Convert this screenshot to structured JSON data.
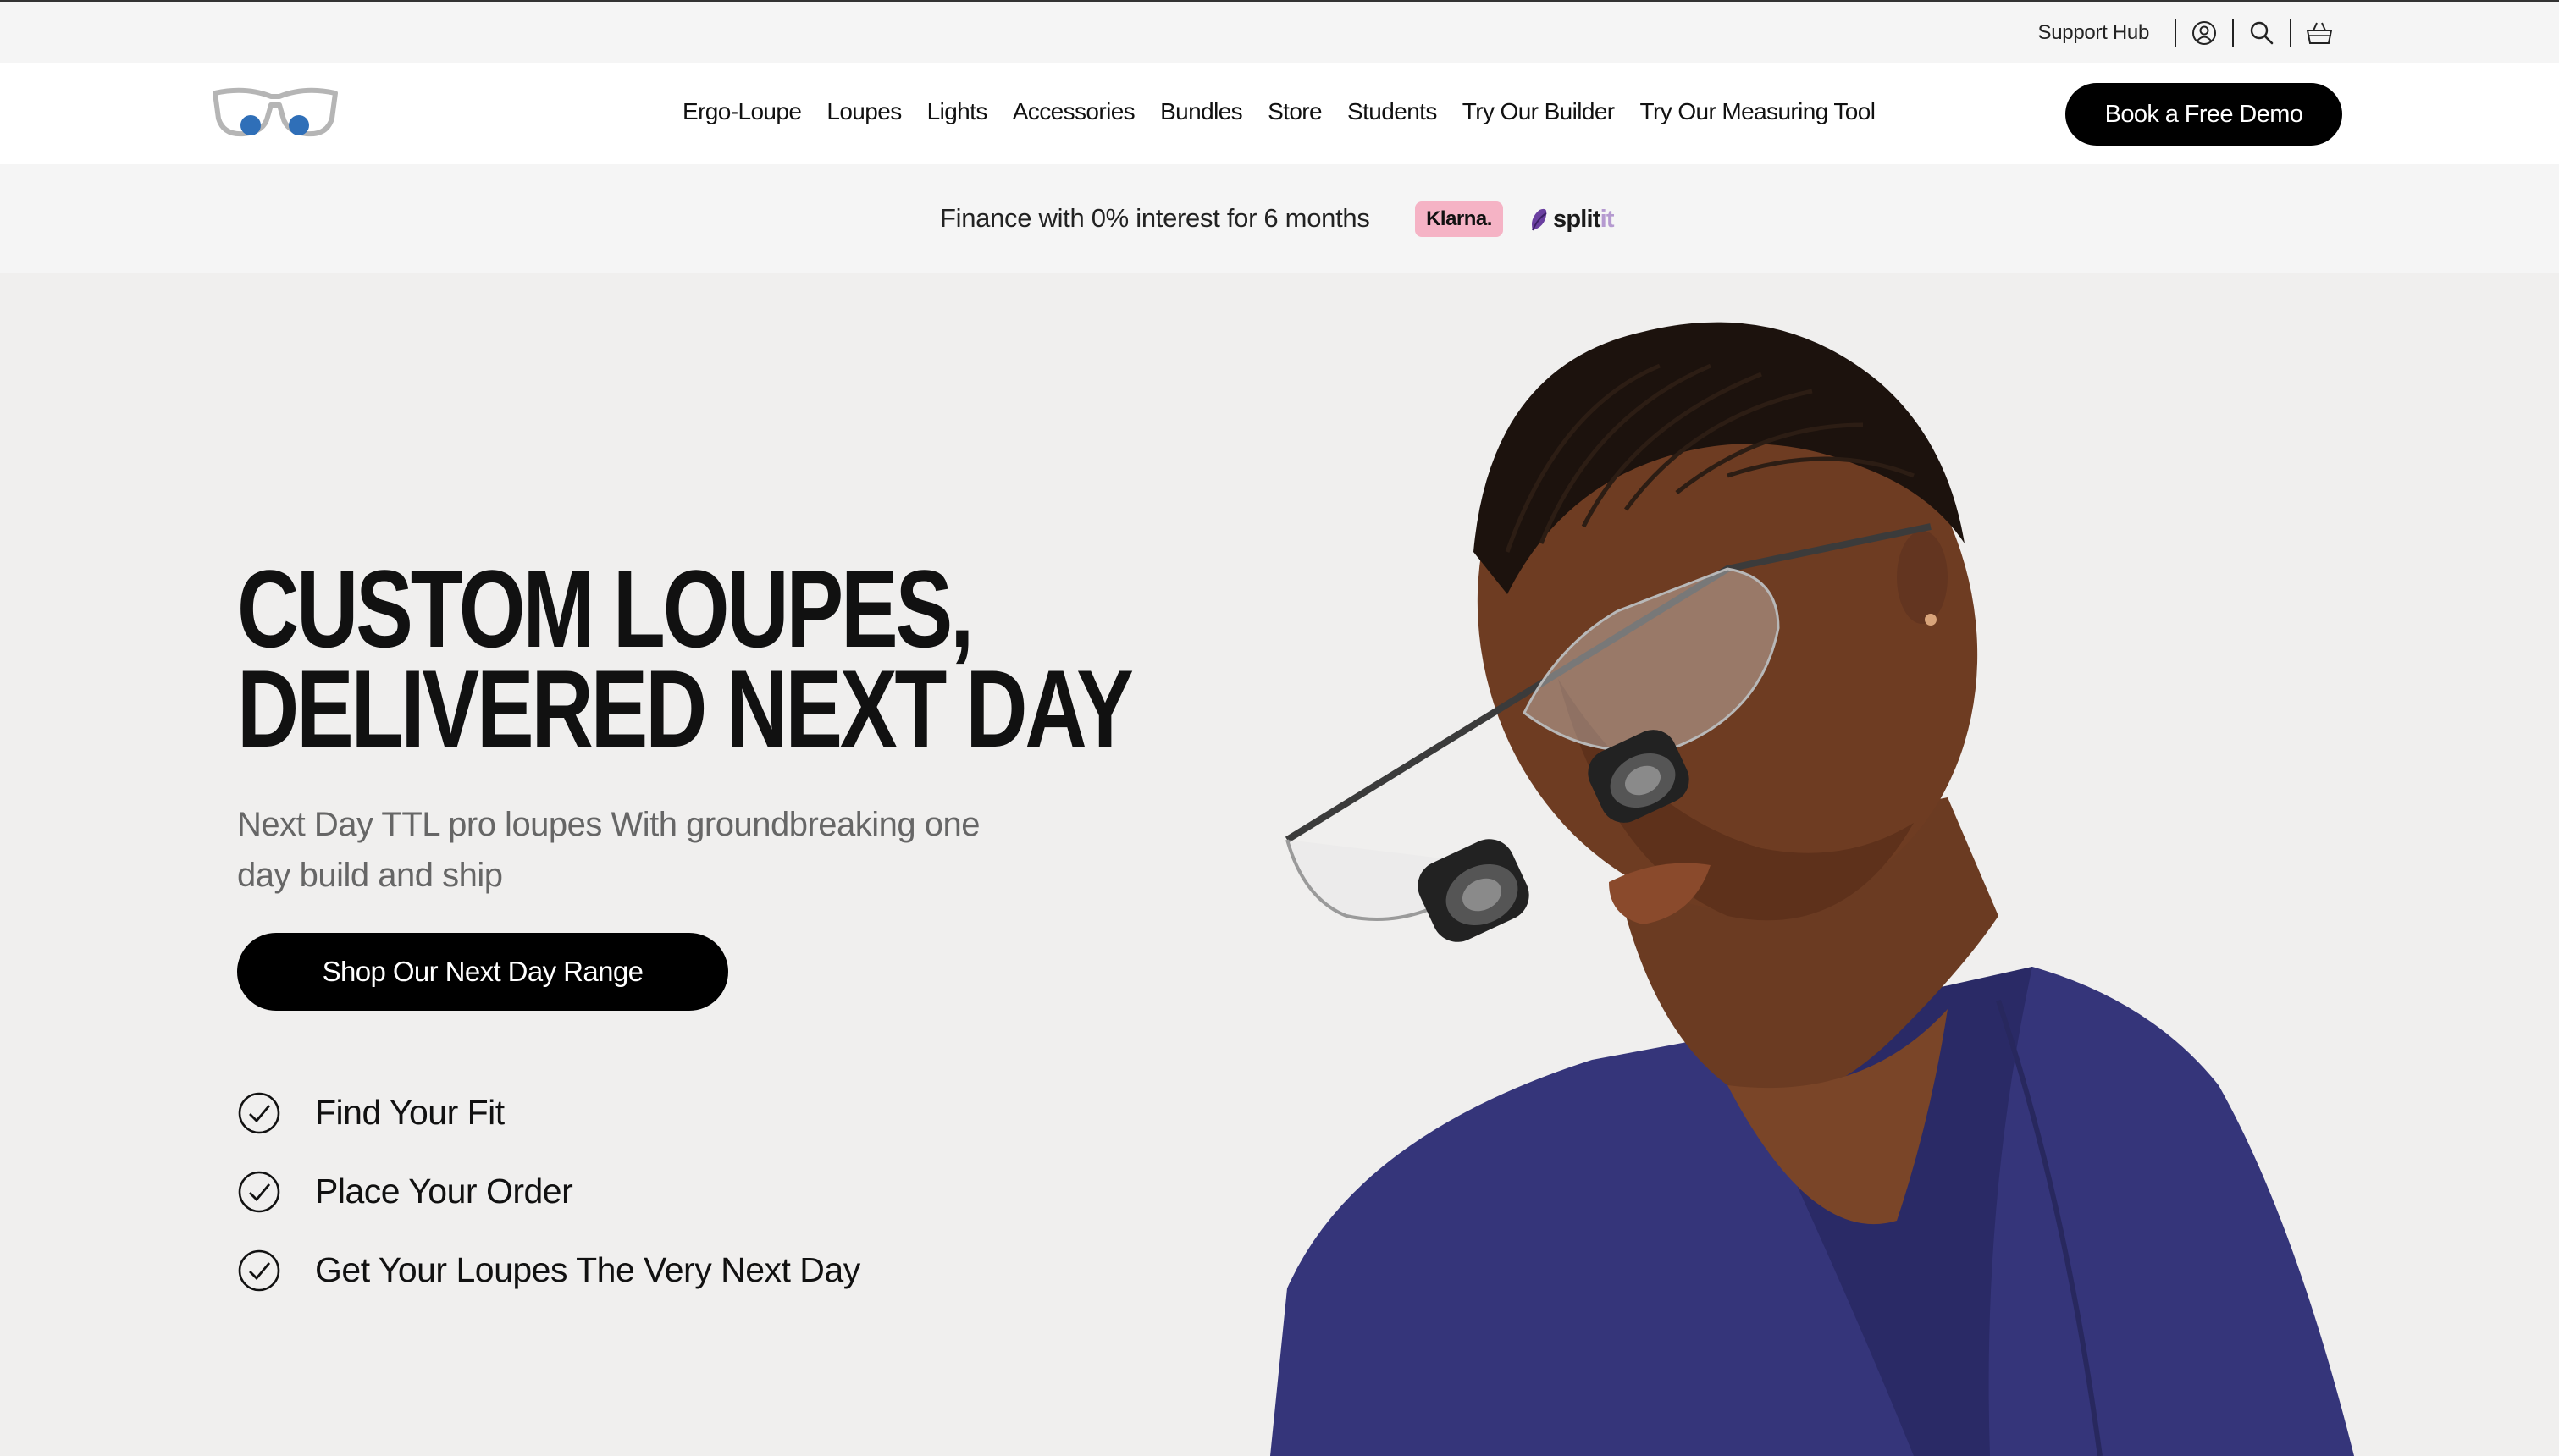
{
  "utility_bar": {
    "support_label": "Support Hub",
    "icons": [
      "account-icon",
      "search-icon",
      "cart-icon"
    ]
  },
  "nav": {
    "logo_icon": "glasses-logo-icon",
    "items": [
      {
        "label": "Ergo-Loupe"
      },
      {
        "label": "Loupes"
      },
      {
        "label": "Lights"
      },
      {
        "label": "Accessories"
      },
      {
        "label": "Bundles"
      },
      {
        "label": "Store"
      },
      {
        "label": "Students"
      },
      {
        "label": "Try Our Builder"
      },
      {
        "label": "Try Our Measuring Tool"
      }
    ],
    "cta_label": "Book a Free Demo"
  },
  "finance_bar": {
    "text": "Finance with 0% interest for 6 months",
    "klarna_label": "Klarna.",
    "splitit_label": "split",
    "splitit_suffix": "it"
  },
  "hero": {
    "headline_line1": "CUSTOM LOUPES,",
    "headline_line2": "DELIVERED NEXT DAY",
    "subtitle": "Next Day TTL pro loupes With groundbreaking one day build and ship",
    "cta_label": "Shop Our Next Day Range",
    "steps": [
      {
        "label": "Find Your Fit"
      },
      {
        "label": "Place Your Order"
      },
      {
        "label": "Get Your Loupes The Very Next Day"
      }
    ]
  },
  "colors": {
    "accent_blue": "#2f6fb8",
    "button_black": "#000000",
    "klarna_pink": "#f5b3c5",
    "splitit_purple": "#6a3fa0",
    "hero_bg": "#f0efee",
    "scrubs": "#35357a"
  }
}
